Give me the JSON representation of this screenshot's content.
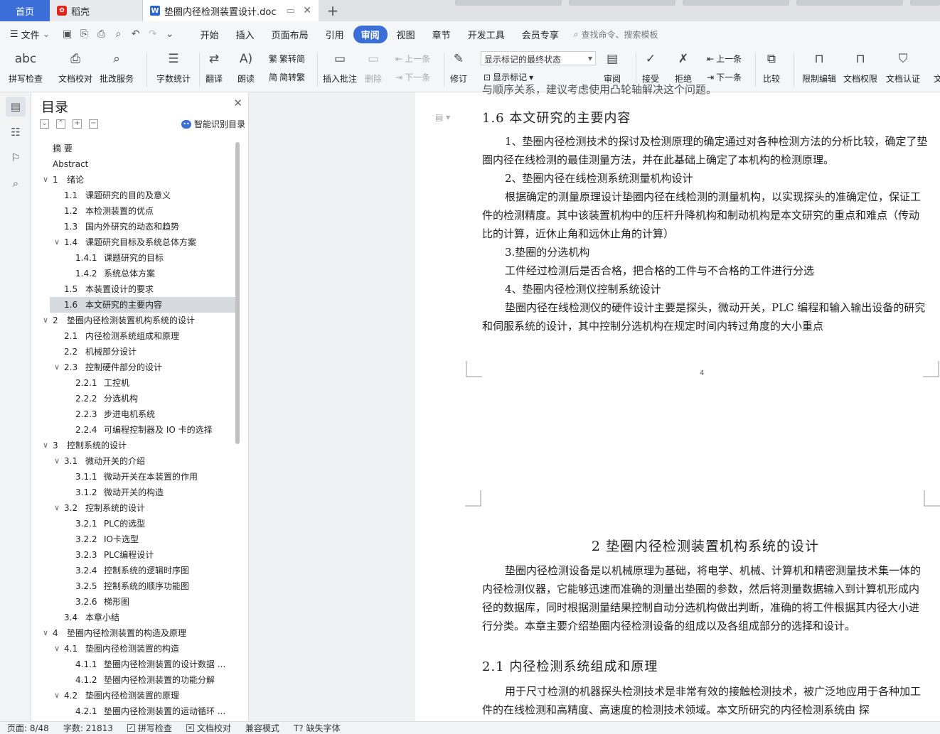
{
  "tabs": {
    "home": "首页",
    "daoke": "稻壳",
    "doc": "垫圈内径检测装置设计.doc"
  },
  "menu": {
    "file": "文件",
    "items": [
      "开始",
      "插入",
      "页面布局",
      "引用",
      "审阅",
      "视图",
      "章节",
      "开发工具",
      "会员专享"
    ],
    "active": "审阅",
    "search": "查找命令、搜索模板"
  },
  "ribbon": {
    "spell": "拼写检查",
    "proof": "文档校对",
    "batch": "批改服务",
    "wordcount": "字数统计",
    "translate": "翻译",
    "read": "朗读",
    "to_trad": "繁转简",
    "to_simp": "简转繁",
    "insert_comment": "插入批注",
    "delete": "删除",
    "prev": "上一条",
    "next": "下一条",
    "revise": "修订",
    "markup_state": "显示标记的最终状态",
    "show_markup": "显示标记",
    "review": "审阅",
    "accept": "接受",
    "reject": "拒绝",
    "prev2": "上一条",
    "next2": "下一条",
    "compare": "比较",
    "restrict": "限制编辑",
    "perm": "文档权限",
    "cert": "文档认证",
    "more": "文"
  },
  "toc": {
    "title": "目录",
    "smart": "智能识别目录",
    "items": [
      {
        "num": "",
        "text": "摘  要",
        "level": 0
      },
      {
        "num": "",
        "text": "Abstract",
        "level": 0
      },
      {
        "num": "1",
        "text": "绪论",
        "level": 1,
        "toggle": true
      },
      {
        "num": "1.1",
        "text": "课题研究的目的及意义",
        "level": 2
      },
      {
        "num": "1.2",
        "text": "本检测装置的优点",
        "level": 2
      },
      {
        "num": "1.3",
        "text": "国内外研究的动态和趋势",
        "level": 2
      },
      {
        "num": "1.4",
        "text": "课题研究目标及系统总体方案",
        "level": 2,
        "toggle": true
      },
      {
        "num": "1.4.1",
        "text": "课题研究的目标",
        "level": 3
      },
      {
        "num": "1.4.2",
        "text": "系统总体方案",
        "level": 3
      },
      {
        "num": "1.5",
        "text": "本装置设计的要求",
        "level": 2
      },
      {
        "num": "1.6",
        "text": "本文研究的主要内容",
        "level": 2,
        "selected": true
      },
      {
        "num": "2",
        "text": "垫圈内径检测装置机构系统的设计",
        "level": 1,
        "toggle": true
      },
      {
        "num": "2.1",
        "text": "内径检测系统组成和原理",
        "level": 2
      },
      {
        "num": "2.2",
        "text": "机械部分设计",
        "level": 2
      },
      {
        "num": "2.3",
        "text": "控制硬件部分的设计",
        "level": 2,
        "toggle": true
      },
      {
        "num": "2.2.1",
        "text": "工控机",
        "level": 3
      },
      {
        "num": "2.2.2",
        "text": "分选机构",
        "level": 3
      },
      {
        "num": "2.2.3",
        "text": "步进电机系统",
        "level": 3
      },
      {
        "num": "2.2.4",
        "text": "可编程控制器及  IO  卡的选择",
        "level": 3
      },
      {
        "num": "3",
        "text": "控制系统的设计",
        "level": 1,
        "toggle": true
      },
      {
        "num": "3.1",
        "text": "微动开关的介绍",
        "level": 2,
        "toggle": true
      },
      {
        "num": "3.1.1",
        "text": "微动开关在本装置的作用",
        "level": 3
      },
      {
        "num": "3.1.2",
        "text": "微动开关的构造",
        "level": 3
      },
      {
        "num": "3.2",
        "text": "控制系统的设计",
        "level": 2,
        "toggle": true
      },
      {
        "num": "3.2.1",
        "text": "PLC的选型",
        "level": 3
      },
      {
        "num": "3.2.2",
        "text": "IO卡选型",
        "level": 3
      },
      {
        "num": "3.2.3",
        "text": "PLC编程设计",
        "level": 3
      },
      {
        "num": "3.2.4",
        "text": "控制系统的逻辑时序图",
        "level": 3
      },
      {
        "num": "3.2.5",
        "text": "控制系统的顺序功能图",
        "level": 3
      },
      {
        "num": "3.2.6",
        "text": "梯形图",
        "level": 3
      },
      {
        "num": "3.4",
        "text": "本章小结",
        "level": 2
      },
      {
        "num": "4",
        "text": "垫圈内径检测装置的构造及原理",
        "level": 1,
        "toggle": true
      },
      {
        "num": "4.1",
        "text": "垫圈内径检测装置的构造",
        "level": 2,
        "toggle": true
      },
      {
        "num": "4.1.1",
        "text": "垫圈内径检测装置的设计数据 ...",
        "level": 3
      },
      {
        "num": "4.1.2",
        "text": "垫圈内径检测装置的功能分解",
        "level": 3
      },
      {
        "num": "4.2",
        "text": "垫圈内径检测装置的原理",
        "level": 2,
        "toggle": true
      },
      {
        "num": "4.2.1",
        "text": "垫圈内径检测装置的运动循环 ...",
        "level": 3
      }
    ]
  },
  "page1": {
    "top_cut": "与顺序关系，建议考虑使用凸轮轴解决这个问题。",
    "heading": "1.6   本文研究的主要内容",
    "paras": [
      {
        "indent": true,
        "text": "1、垫圈内径检测技术的探讨及检测原理的确定通过对各种检测方法的分析比较，确定了垫圈内径在线检测的最佳测量方法，并在此基础上确定了本机构的检测原理。"
      },
      {
        "indent": true,
        "text": "2、垫圈内径在线检测系统测量机构设计"
      },
      {
        "indent": true,
        "text": "根据确定的测量原理设计垫圈内径在线检测的测量机构，以实现探头的准确定位，保证工件的检测精度。其中该装置机构中的压杆升降机构和制动机构是本文研究的重点和难点（传动比的计算，近休止角和远休止角的计算）"
      },
      {
        "indent": true,
        "text": "3.垫圈的分选机构"
      },
      {
        "indent": true,
        "text": "工件经过检测后是否合格，把合格的工件与不合格的工件进行分选"
      },
      {
        "indent": true,
        "text": "4、垫圈内径检测仪控制系统设计"
      },
      {
        "indent": true,
        "text": "垫圈内径在线检测仪的硬件设计主要是探头，微动开关，PLC 编程和输入输出设备的研究和伺服系统的设计，其中控制分选机构在规定时间内转过角度的大小重点"
      }
    ],
    "page_number": "4"
  },
  "page2": {
    "chapter": "2   垫圈内径检测装置机构系统的设计",
    "intro": "垫圈内径检测设备是以机械原理为基础，将电学、机械、计算机和精密测量技术集一体的内径检测仪器，它能够迅速而准确的测量出垫圈的参数，然后将测量数据输入到计算机形成内径的数据库，同时根据测量结果控制自动分选机构做出判断，准确的将工件根据其内径大小进行分类。本章主要介绍垫圈内径检测设备的组成以及各组成部分的选择和设计。",
    "heading": "2.1   内径检测系统组成和原理",
    "para": "用于尺寸检测的机器探头检测技术是非常有效的接触检测技术，被广泛地应用于各种加工件的在线检测和高精度、高速度的检测技术领域。本文所研究的内径检测系统由 探"
  },
  "status": {
    "page": "页面: 8/48",
    "words": "字数: 21813",
    "spell": "拼写检查",
    "proof": "文档校对",
    "compat": "兼容模式",
    "font": "缺失字体"
  }
}
